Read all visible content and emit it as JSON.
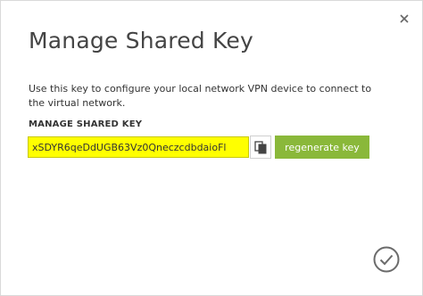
{
  "dialog": {
    "title": "Manage Shared Key",
    "description": "Use this key to configure your local network VPN device to connect to the virtual network.",
    "section_label": "MANAGE SHARED KEY",
    "shared_key_value": "xSDYR6qeDdUGB63Vz0QneczcdbdaioFl",
    "regenerate_label": "regenerate key",
    "icons": {
      "close": "close-icon",
      "copy": "copy-icon",
      "confirm": "checkmark-icon"
    }
  },
  "colors": {
    "key_highlight": "#ffff00",
    "regenerate_button": "#8ab83a",
    "title_text": "#444444"
  }
}
